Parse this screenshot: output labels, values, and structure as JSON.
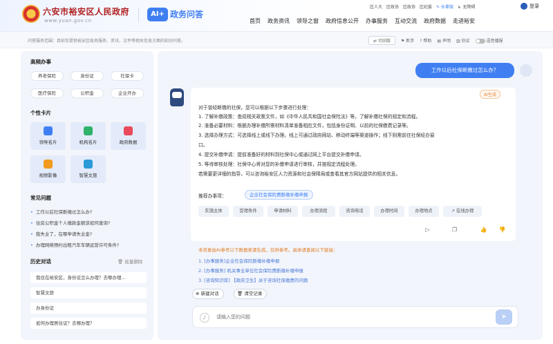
{
  "header": {
    "gov_name": "六安市裕安区人民政府",
    "gov_url": "www.yuan.gov.cn",
    "ai_logo": "AI+",
    "ai_title": "政务问答",
    "top_links": [
      "区人大",
      "区政协",
      "区政协",
      "区纪委"
    ],
    "elderly": "长辈版",
    "barrier_free": "无障碍",
    "login": "登录",
    "nav": [
      "首页",
      "政务资讯",
      "领导之窗",
      "政府信息公开",
      "办事服务",
      "互动交流",
      "政府数据",
      "走进裕安"
    ]
  },
  "tipbar": {
    "text": "问答服务范围：目前仅提供裕安区政务服务、资讯、文件等相关信息方面的知识问答。",
    "switch_label": "切旧版",
    "newbie": "新手",
    "help": "帮助",
    "statement": "声明",
    "agreement": "协议",
    "sound": "语音播报"
  },
  "sidebar": {
    "hot_title": "高频办事",
    "hot_items": [
      "养老保险",
      "身份证",
      "社保卡",
      "医疗保险",
      "公积金",
      "企业开办"
    ],
    "personal_title": "个性卡片",
    "cards": [
      {
        "label": "领导名片",
        "color": "#3f7ff2"
      },
      {
        "label": "机构名片",
        "color": "#2fb36a"
      },
      {
        "label": "政府数据",
        "color": "#e94b5a"
      },
      {
        "label": "视频影像",
        "color": "#f29a1f"
      },
      {
        "label": "智慧文旅",
        "color": "#2a9ad8"
      }
    ],
    "faq_title": "常见问题",
    "faq": [
      "工作以后社保断缴过怎么办?",
      "住房公积金个人缴款金额该如何查询?",
      "我失业了，在哪申请失业金?",
      "办理网络预约出租汽车车辆运营许可条件?"
    ],
    "history_title": "历史对话",
    "batch_delete": "批量删除",
    "history": [
      "我住在裕安区，身份证怎么办理？去哪办理...",
      "智慧文旅",
      "办身份证",
      "如何办理居住证？去哪办理？"
    ]
  },
  "chat": {
    "user_question": "工作以后社保断缴过怎么办？",
    "ai_tag": "AI生成",
    "answer_lines": [
      "对于曾经断缴的社保，您可以根据以下步骤进行处理：",
      "1. 了解补缴政策：查阅相关政策文件，如《中华人民共和国社会保险法》等，了解补缴社保的规定和流程。",
      "2. 准备必要材料：根据办理补缴所需材料清单准备相应文件，包括身份证明、以前的社保缴费记录等。",
      "3. 选择办理方式：可选择线上或线下办理。线上可通过政府网站、移动终端等渠道操作；线下则需前往社保经办窗",
      "口。",
      "4. 提交补缴申请：提前准备好的材料到社保中心或通过网上平台提交补缴申请。",
      "5. 等待审核处理：社保中心将对您的补缴申请进行审核，并按规定流程处理。",
      "若需要更详细的指导，可以咨询裕安区人力资源和社会保障局或查看其官方网站提供的相关信息。"
    ],
    "recommend_label": "推荐办事项：",
    "recommend_item": "企业社会保险费断缴补缴申报",
    "subtabs": [
      "实施主体",
      "受理条件",
      "申请材料",
      "办理流程",
      "咨询电话",
      "办理时间",
      "办理地点",
      "在线办理"
    ],
    "disclaimer": "本答复由AI参考以下数据来源生成，仅供参考。具体请查阅以下链接：",
    "links": [
      "1. [办事服务]企业社会保险断缴补缴申报",
      "2. [办事服务] 机关事业单位社会保险费断缴补缴申报",
      "3. [咨询知识库] 【政府卫生】关于咨询社保缴费的问题"
    ],
    "new_chat": "新建对话",
    "clear": "清空记录",
    "input_placeholder": "请输入您的问题"
  }
}
